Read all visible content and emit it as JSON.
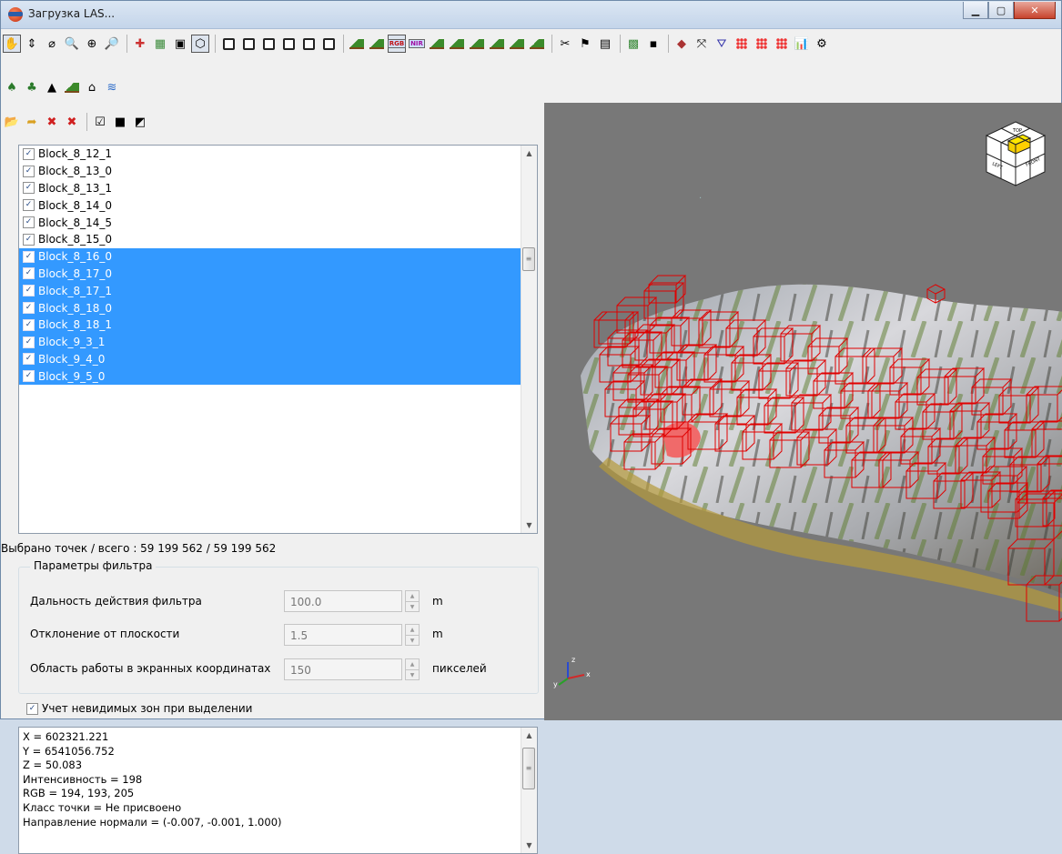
{
  "window": {
    "title": "Загрузка LAS..."
  },
  "list": {
    "items": [
      {
        "label": "Block_8_12_1",
        "checked": true,
        "selected": false
      },
      {
        "label": "Block_8_13_0",
        "checked": true,
        "selected": false
      },
      {
        "label": "Block_8_13_1",
        "checked": true,
        "selected": false
      },
      {
        "label": "Block_8_14_0",
        "checked": true,
        "selected": false
      },
      {
        "label": "Block_8_14_5",
        "checked": true,
        "selected": false
      },
      {
        "label": "Block_8_15_0",
        "checked": true,
        "selected": false
      },
      {
        "label": "Block_8_16_0",
        "checked": true,
        "selected": true
      },
      {
        "label": "Block_8_17_0",
        "checked": true,
        "selected": true
      },
      {
        "label": "Block_8_17_1",
        "checked": true,
        "selected": true
      },
      {
        "label": "Block_8_18_0",
        "checked": true,
        "selected": true
      },
      {
        "label": "Block_8_18_1",
        "checked": true,
        "selected": true
      },
      {
        "label": "Block_9_3_1",
        "checked": true,
        "selected": true
      },
      {
        "label": "Block_9_4_0",
        "checked": true,
        "selected": true
      },
      {
        "label": "Block_9_5_0",
        "checked": true,
        "selected": true
      }
    ]
  },
  "status": {
    "points_selected": "Выбрано точек / всего : 59 199 562   / 59 199 562"
  },
  "filter": {
    "title": "Параметры фильтра",
    "params": [
      {
        "label": "Дальность действия фильтра",
        "value": "100.0",
        "unit": "m"
      },
      {
        "label": "Отклонение от плоскости",
        "value": "1.5",
        "unit": "m"
      },
      {
        "label": "Область работы в экранных координатах",
        "value": "150",
        "unit": "пикселей"
      }
    ]
  },
  "hidden_zones": {
    "label": "Учет невидимых зон при выделении",
    "checked": true
  },
  "info": {
    "lines": [
      "X = 602321.221",
      "Y = 6541056.752",
      "Z = 50.083",
      "Интенсивность = 198",
      "RGB = 194, 193, 205",
      "Класс точки = Не присвоено",
      "Направление нормали = (-0.007, -0.001, 1.000)"
    ]
  },
  "navcube": {
    "faces": [
      "TOP",
      "LEFT",
      "FRONT"
    ]
  },
  "axes": {
    "x": "x",
    "y": "y",
    "z": "z"
  }
}
